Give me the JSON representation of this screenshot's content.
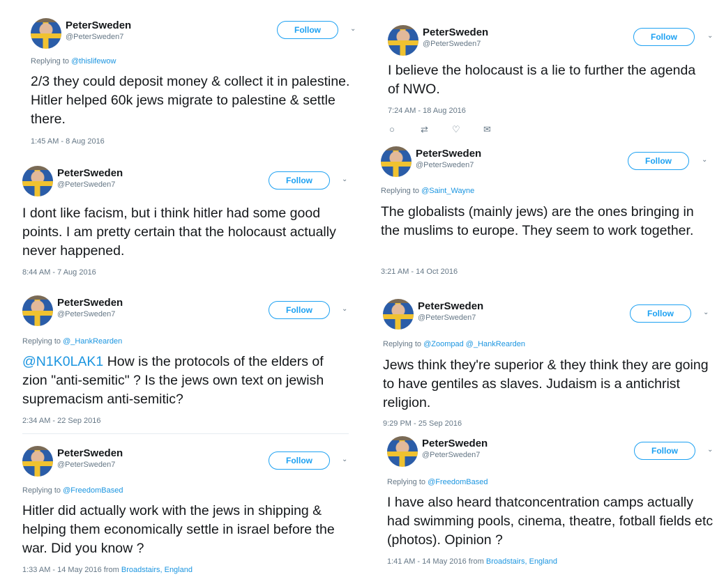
{
  "follow_label": "Follow",
  "caret": "⌄",
  "tweets": [
    {
      "name": "PeterSweden",
      "handle": "@PeterSweden7",
      "replying_prefix": "Replying to",
      "replying_to": "@thislifewow",
      "text": "2/3 they could deposit money & collect it in palestine. Hitler helped 60k jews migrate to palestine & settle there.",
      "time": "1:45 AM - 8 Aug 2016"
    },
    {
      "name": "PeterSweden",
      "handle": "@PeterSweden7",
      "text": "I dont like facism, but i think hitler had some good points. I am pretty certain that the holocaust actually never happened.",
      "time": "8:44 AM - 7 Aug 2016"
    },
    {
      "name": "PeterSweden",
      "handle": "@PeterSweden7",
      "replying_prefix": "Replying to",
      "replying_to": "@_HankRearden",
      "mention": "@N1K0LAK1",
      "text": " How is the protocols of the elders of zion \"anti-semitic\" ? Is the jews own text on jewish supremacism anti-semitic?",
      "time": "2:34 AM - 22 Sep 2016"
    },
    {
      "name": "PeterSweden",
      "handle": "@PeterSweden7",
      "replying_prefix": "Replying to",
      "replying_to": "@FreedomBased",
      "text": "Hitler did actually work with the jews in shipping & helping them economically settle in israel before the war. Did you know ?",
      "time": "1:33 AM - 14 May 2016 from",
      "location": "Broadstairs, England"
    },
    {
      "name": "PeterSweden",
      "handle": "@PeterSweden7",
      "text": "I believe the holocaust is a lie to further the agenda of NWO.",
      "time": "7:24 AM - 18 Aug 2016"
    },
    {
      "name": "PeterSweden",
      "handle": "@PeterSweden7",
      "replying_prefix": "Replying to",
      "replying_to": "@Saint_Wayne",
      "text": "The globalists (mainly jews) are the ones bringing in the muslims to europe. They seem to work together.",
      "time": "3:21 AM - 14 Oct 2016"
    },
    {
      "name": "PeterSweden",
      "handle": "@PeterSweden7",
      "replying_prefix": "Replying to",
      "replying_to": "@Zoompad @_HankRearden",
      "text": "Jews think they're superior & they think they are going to have gentiles as slaves. Judaism is a antichrist religion.",
      "time": "9:29 PM - 25 Sep 2016"
    },
    {
      "name": "PeterSweden",
      "handle": "@PeterSweden7",
      "replying_prefix": "Replying to",
      "replying_to": "@FreedomBased",
      "text": "I have also heard thatconcentration camps actually had swimming pools, cinema, theatre, fotball fields etc (photos). Opinion ?",
      "time": "1:41 AM - 14 May 2016 from",
      "location": "Broadstairs, England"
    }
  ],
  "actions": {
    "reply": "○",
    "retweet": "⇄",
    "like": "♡",
    "message": "✉"
  }
}
